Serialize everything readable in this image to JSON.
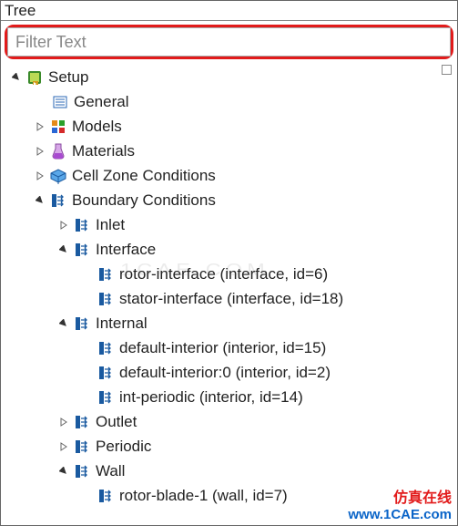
{
  "panel": {
    "title": "Tree"
  },
  "filter": {
    "placeholder": "Filter Text",
    "value": ""
  },
  "tree": {
    "setup": {
      "label": "Setup"
    },
    "general": {
      "label": "General"
    },
    "models": {
      "label": "Models"
    },
    "materials": {
      "label": "Materials"
    },
    "czc": {
      "label": "Cell Zone Conditions"
    },
    "bc": {
      "label": "Boundary Conditions"
    },
    "inlet": {
      "label": "Inlet"
    },
    "interface": {
      "label": "Interface"
    },
    "rotor_interface": {
      "label": "rotor-interface (interface, id=6)"
    },
    "stator_interface": {
      "label": "stator-interface (interface, id=18)"
    },
    "internal": {
      "label": "Internal"
    },
    "def_int_15": {
      "label": "default-interior (interior, id=15)"
    },
    "def_int_2": {
      "label": "default-interior:0 (interior, id=2)"
    },
    "int_periodic": {
      "label": "int-periodic (interior, id=14)"
    },
    "outlet": {
      "label": "Outlet"
    },
    "periodic": {
      "label": "Periodic"
    },
    "wall": {
      "label": "Wall"
    },
    "rotor_blade_1": {
      "label": "rotor-blade-1 (wall, id=7)"
    }
  },
  "watermark": {
    "text": "1CAE.COM"
  },
  "brand": {
    "cn": "仿真在线",
    "en": "www.1CAE.com"
  }
}
